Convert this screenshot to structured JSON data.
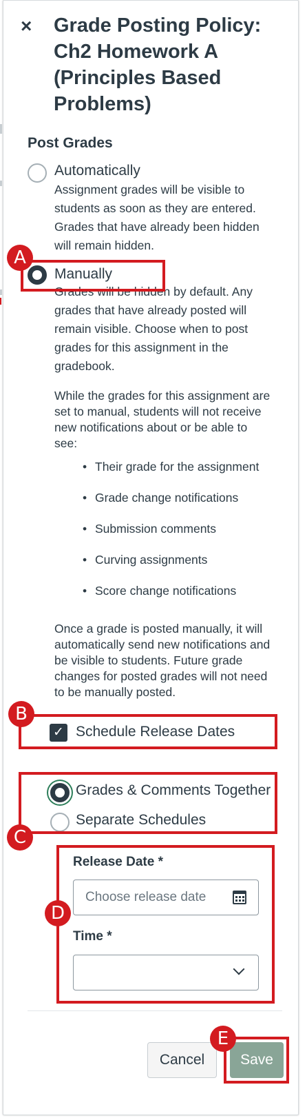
{
  "header": {
    "close_glyph": "×",
    "title": "Grade Posting Policy: Ch2 Homework A (Principles Based Problems)"
  },
  "post_grades": {
    "label": "Post Grades",
    "automatically": {
      "label": "Automatically",
      "selected": false,
      "description": "Assignment grades will be visible to students as soon as they are entered. Grades that have already been hidden will remain hidden."
    },
    "manually": {
      "label": "Manually",
      "selected": true,
      "description": "Grades will be hidden by default. Any grades that have already posted will remain visible. Choose when to post grades for this assignment in the gradebook.",
      "notice": "While the grades for this assignment are set to manual, students will not receive new notifications about or be able to see:",
      "bullets": [
        "Their grade for the assignment",
        "Grade change notifications",
        "Submission comments",
        "Curving assignments",
        "Score change notifications"
      ],
      "footer": "Once a grade is posted manually, it will automatically send new notifications and be visible to students. Future grade changes for posted grades will not need to be manually posted."
    }
  },
  "schedule": {
    "checkbox_label": "Schedule Release Dates",
    "checked": true,
    "options": [
      {
        "label": "Grades & Comments Together",
        "selected": true
      },
      {
        "label": "Separate Schedules",
        "selected": false
      }
    ]
  },
  "release": {
    "date_label": "Release Date *",
    "date_placeholder": "Choose release date",
    "time_label": "Time *",
    "time_value": ""
  },
  "actions": {
    "cancel": "Cancel",
    "save": "Save"
  },
  "callouts": [
    "A",
    "B",
    "C",
    "D",
    "E"
  ],
  "colors": {
    "callout_red": "#d31b20",
    "save_button": "#89a597",
    "text": "#2d3b45"
  }
}
